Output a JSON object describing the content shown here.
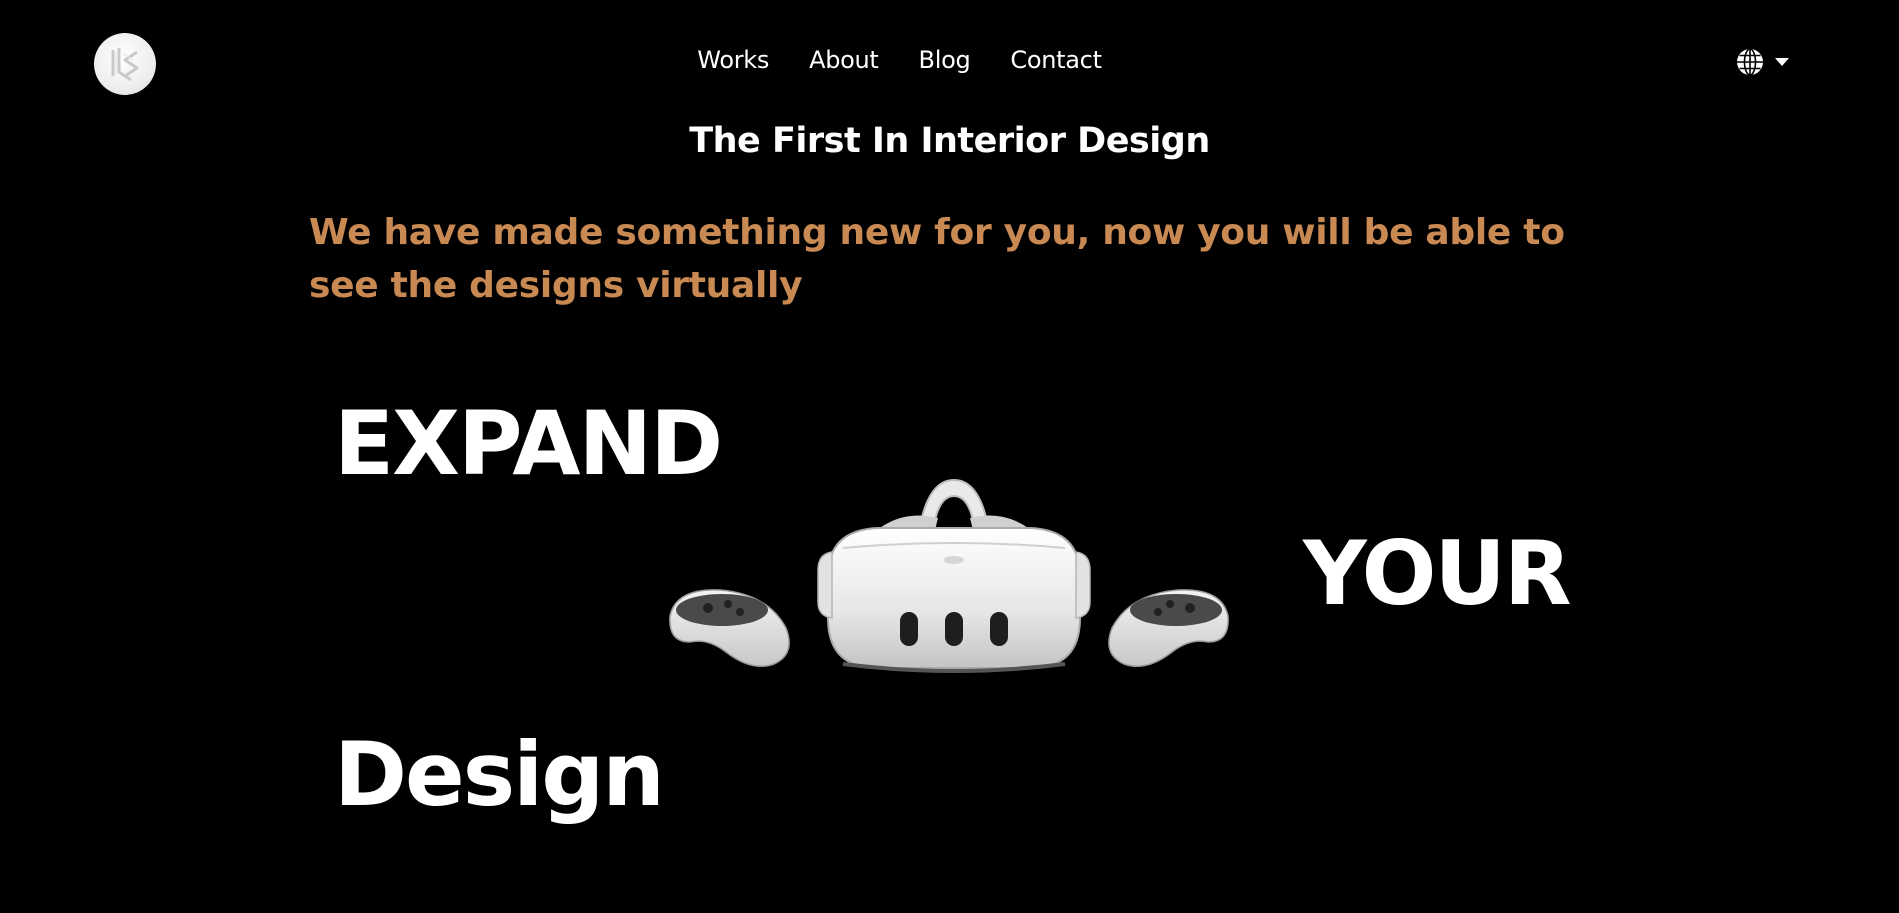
{
  "header": {
    "logo_name": "brand-logo",
    "nav": [
      {
        "label": "Works"
      },
      {
        "label": "About"
      },
      {
        "label": "Blog"
      },
      {
        "label": "Contact"
      }
    ],
    "language_icon": "globe-icon"
  },
  "hero": {
    "headline": "The First In Interior Design",
    "subtext": "We have made something new for you, now you will be able to see the designs virtually",
    "word_1": "EXPAND",
    "word_2": "YOUR",
    "word_3": "Design",
    "image": "vr-headset-with-controllers"
  },
  "colors": {
    "background": "#000000",
    "accent": "#c98952",
    "text": "#ffffff"
  }
}
